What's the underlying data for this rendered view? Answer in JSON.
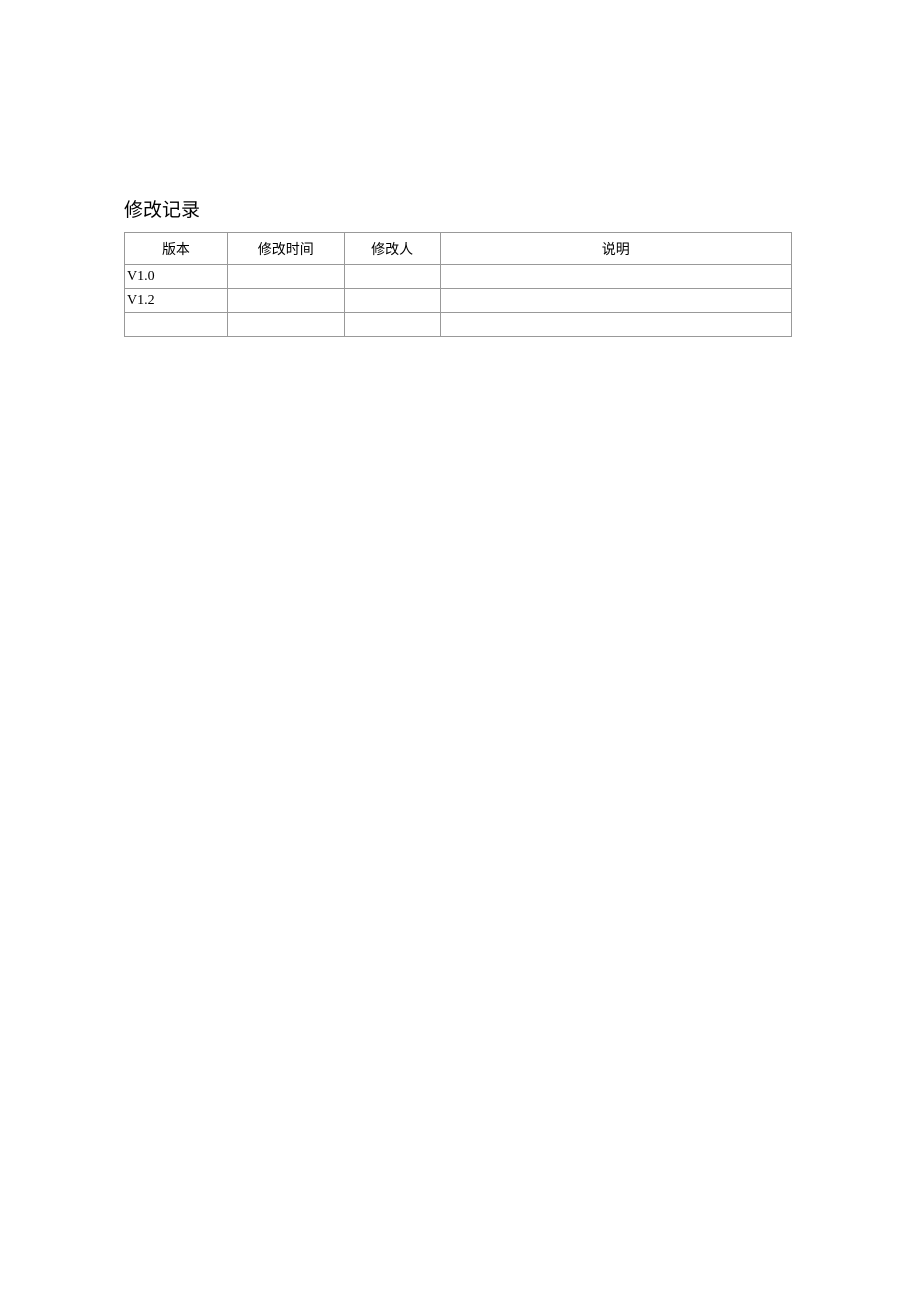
{
  "title": "修改记录",
  "headers": {
    "version": "版本",
    "time": "修改时间",
    "author": "修改人",
    "description": "说明"
  },
  "rows": [
    {
      "version": "V1.0",
      "time": "",
      "author": "",
      "description": ""
    },
    {
      "version": "V1.2",
      "time": "",
      "author": "",
      "description": ""
    },
    {
      "version": "",
      "time": "",
      "author": "",
      "description": ""
    }
  ]
}
